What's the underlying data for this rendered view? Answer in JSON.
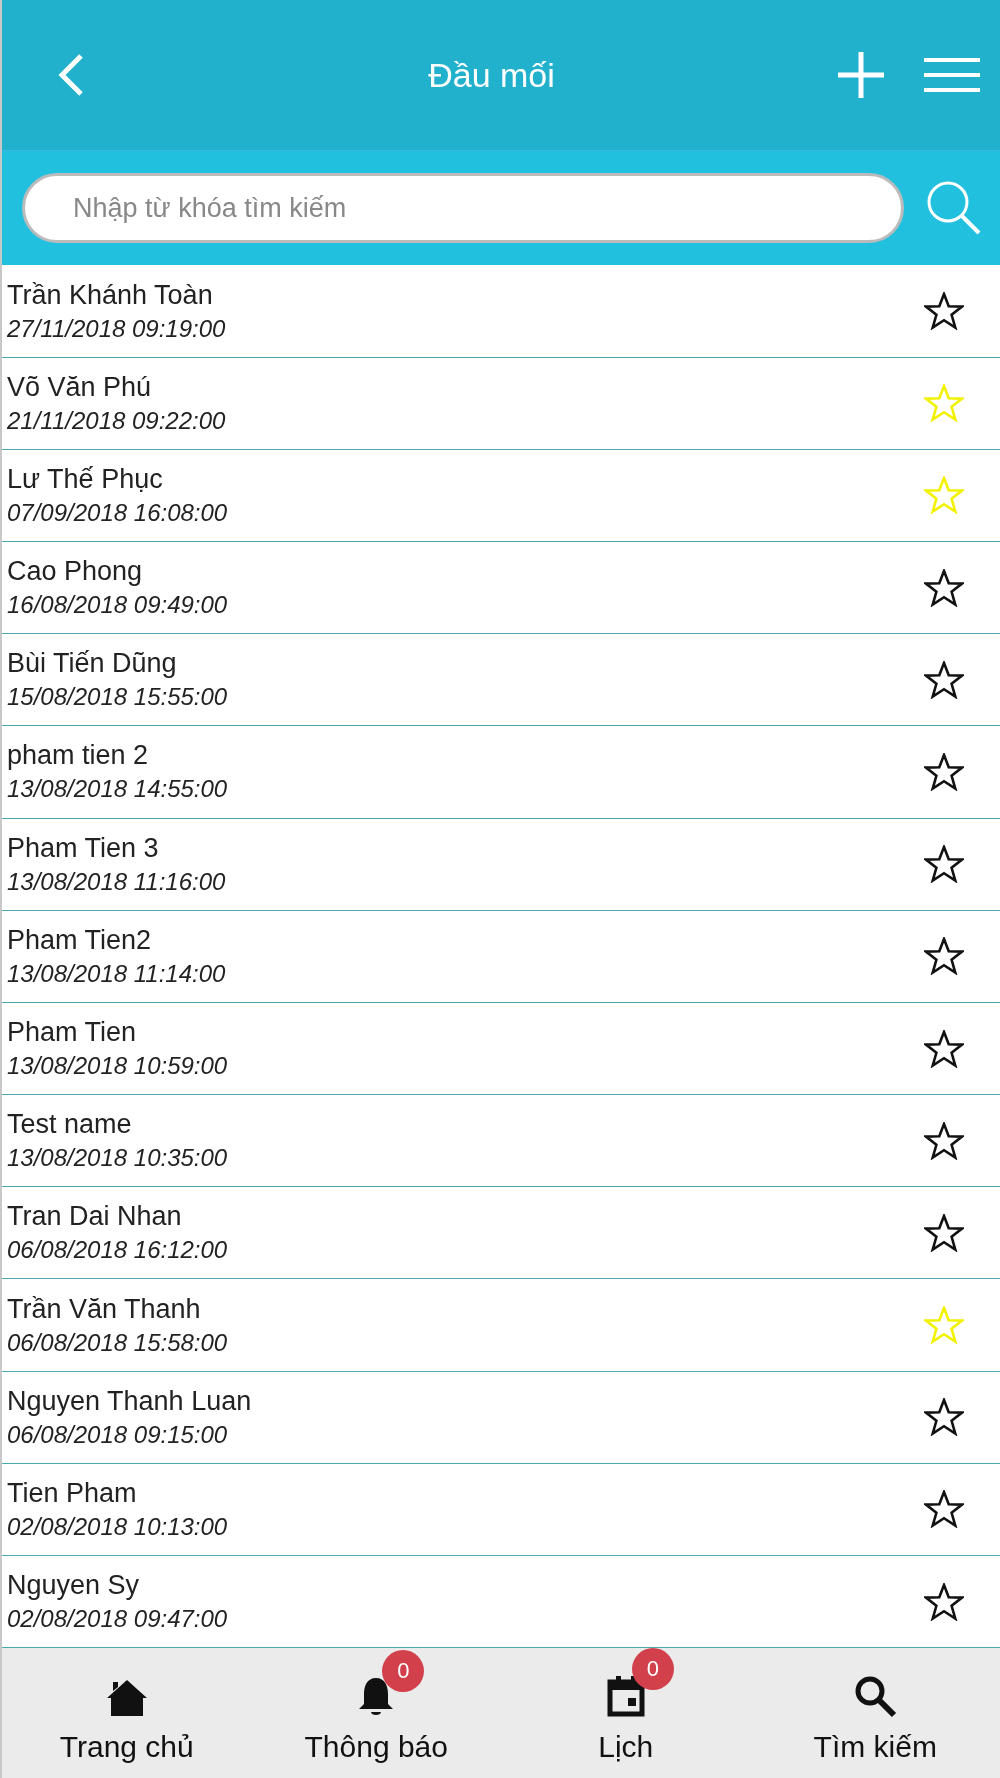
{
  "header": {
    "title": "Đầu mối"
  },
  "search": {
    "placeholder": "Nhập từ khóa tìm kiếm"
  },
  "contacts": [
    {
      "name": "Trần Khánh Toàn",
      "date": "27/11/2018 09:19:00",
      "favorite": false
    },
    {
      "name": "Võ Văn Phú",
      "date": "21/11/2018 09:22:00",
      "favorite": true
    },
    {
      "name": "Lư Thế Phục",
      "date": "07/09/2018 16:08:00",
      "favorite": true
    },
    {
      "name": "Cao Phong",
      "date": "16/08/2018 09:49:00",
      "favorite": false
    },
    {
      "name": "Bùi Tiến Dũng",
      "date": "15/08/2018 15:55:00",
      "favorite": false
    },
    {
      "name": "pham tien 2",
      "date": "13/08/2018 14:55:00",
      "favorite": false
    },
    {
      "name": "Pham Tien 3",
      "date": "13/08/2018 11:16:00",
      "favorite": false
    },
    {
      "name": "Pham Tien2",
      "date": "13/08/2018 11:14:00",
      "favorite": false
    },
    {
      "name": "Pham Tien",
      "date": "13/08/2018 10:59:00",
      "favorite": false
    },
    {
      "name": "Test name",
      "date": "13/08/2018 10:35:00",
      "favorite": false
    },
    {
      "name": "Tran Dai Nhan",
      "date": "06/08/2018 16:12:00",
      "favorite": false
    },
    {
      "name": "Trần Văn Thanh",
      "date": "06/08/2018 15:58:00",
      "favorite": true
    },
    {
      "name": "Nguyen Thanh Luan",
      "date": "06/08/2018 09:15:00",
      "favorite": false
    },
    {
      "name": "Tien Pham",
      "date": "02/08/2018 10:13:00",
      "favorite": false
    },
    {
      "name": "Nguyen Sy",
      "date": "02/08/2018 09:47:00",
      "favorite": false
    }
  ],
  "bottom_nav": [
    {
      "kind": "home",
      "label": "Trang chủ"
    },
    {
      "kind": "bell",
      "label": "Thông báo",
      "badge": "0"
    },
    {
      "kind": "calendar",
      "label": "Lịch",
      "badge": "0"
    },
    {
      "kind": "search",
      "label": "Tìm kiếm"
    }
  ]
}
